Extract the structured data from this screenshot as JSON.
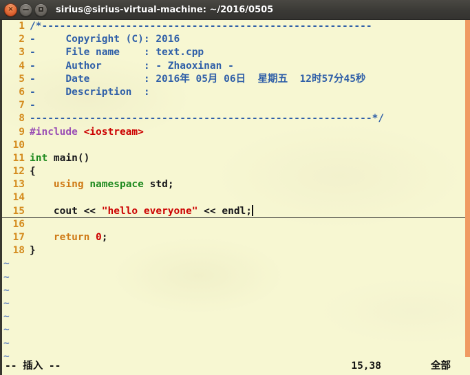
{
  "window": {
    "title": "sirius@sirius-virtual-machine: ~/2016/0505",
    "controls": [
      {
        "name": "close-button",
        "glyph": "×"
      },
      {
        "name": "minimize-button",
        "glyph": "−"
      },
      {
        "name": "maximize-button",
        "glyph": "□"
      }
    ]
  },
  "editor": {
    "colors": {
      "background": "#f7f7d2",
      "line_number": "#d48b1e",
      "comment": "#2f5fa8",
      "preproc": "#9a4fb5",
      "string": "#cc0000",
      "type": "#1f8a1f",
      "statement": "#cf7a16",
      "tilde": "#5f81bf",
      "scrollbar": "#f09a63",
      "titlebar": "#3b3a36"
    },
    "lines": [
      {
        "num": "1",
        "segments": [
          {
            "cls": "c-comment",
            "text": "/*-------------------------------------------------------"
          }
        ]
      },
      {
        "num": "2",
        "segments": [
          {
            "cls": "c-comment",
            "text": "-     Copyright (C): 2016"
          }
        ]
      },
      {
        "num": "3",
        "segments": [
          {
            "cls": "c-comment",
            "text": "-     File name    : text.cpp"
          }
        ]
      },
      {
        "num": "4",
        "segments": [
          {
            "cls": "c-comment",
            "text": "-     Author       : - Zhaoxinan -"
          }
        ]
      },
      {
        "num": "5",
        "segments": [
          {
            "cls": "c-comment",
            "text": "-     Date         : 2016年 05月 06日  星期五  12时57分45秒"
          }
        ]
      },
      {
        "num": "6",
        "segments": [
          {
            "cls": "c-comment",
            "text": "-     Description  :"
          }
        ]
      },
      {
        "num": "7",
        "segments": [
          {
            "cls": "c-comment",
            "text": "-"
          }
        ]
      },
      {
        "num": "8",
        "segments": [
          {
            "cls": "c-comment",
            "text": "---------------------------------------------------------*/"
          }
        ]
      },
      {
        "num": "9",
        "segments": [
          {
            "cls": "c-preproc",
            "text": "#include "
          },
          {
            "cls": "c-include",
            "text": "<iostream>"
          }
        ]
      },
      {
        "num": "10",
        "segments": [
          {
            "cls": "c-plain",
            "text": ""
          }
        ]
      },
      {
        "num": "11",
        "segments": [
          {
            "cls": "c-type",
            "text": "int "
          },
          {
            "cls": "c-ident",
            "text": "main()"
          }
        ]
      },
      {
        "num": "12",
        "segments": [
          {
            "cls": "c-plain",
            "text": "{"
          }
        ]
      },
      {
        "num": "13",
        "segments": [
          {
            "cls": "c-plain",
            "text": "    "
          },
          {
            "cls": "c-stmt",
            "text": "using "
          },
          {
            "cls": "c-type",
            "text": "namespace "
          },
          {
            "cls": "c-plain",
            "text": "std;"
          }
        ]
      },
      {
        "num": "14",
        "segments": [
          {
            "cls": "c-plain",
            "text": ""
          }
        ]
      },
      {
        "num": "15",
        "cursorline": true,
        "caret": true,
        "segments": [
          {
            "cls": "c-plain",
            "text": "    cout << "
          },
          {
            "cls": "c-string",
            "text": "\"hello everyone\""
          },
          {
            "cls": "c-plain",
            "text": " << endl;"
          }
        ]
      },
      {
        "num": "16",
        "segments": [
          {
            "cls": "c-plain",
            "text": ""
          }
        ]
      },
      {
        "num": "17",
        "segments": [
          {
            "cls": "c-plain",
            "text": "    "
          },
          {
            "cls": "c-stmt",
            "text": "return "
          },
          {
            "cls": "c-number",
            "text": "0"
          },
          {
            "cls": "c-plain",
            "text": ";"
          }
        ]
      },
      {
        "num": "18",
        "segments": [
          {
            "cls": "c-plain",
            "text": "}"
          }
        ]
      }
    ],
    "empty_marker": "~",
    "empty_line_count": 8
  },
  "statusline": {
    "mode": "-- 插入 --",
    "position": "15,38",
    "scroll": "全部"
  }
}
